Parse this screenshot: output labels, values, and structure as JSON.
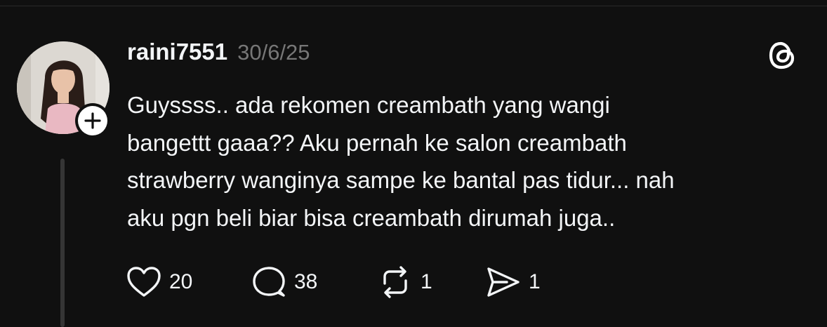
{
  "post": {
    "username": "raini7551",
    "date": "30/6/25",
    "text_lines": [
      "Guyssss.. ada rekomen creambath yang wangi",
      "bangettt gaaa?? Aku pernah ke salon creambath",
      "strawberry wanginya sampe ke bantal pas tidur... nah",
      "aku pgn beli biar bisa creambath dirumah juga.."
    ]
  },
  "actions": {
    "like": {
      "icon": "heart-icon",
      "count": "20"
    },
    "reply": {
      "icon": "comment-icon",
      "count": "38"
    },
    "repost": {
      "icon": "repost-icon",
      "count": "1"
    },
    "share": {
      "icon": "send-icon",
      "count": "1"
    }
  },
  "icons": {
    "follow": "plus-icon",
    "brand": "threads-logo-icon"
  },
  "colors": {
    "background": "#101010",
    "text": "#f3f5f7",
    "muted": "#777777",
    "thread_line": "#353535"
  }
}
